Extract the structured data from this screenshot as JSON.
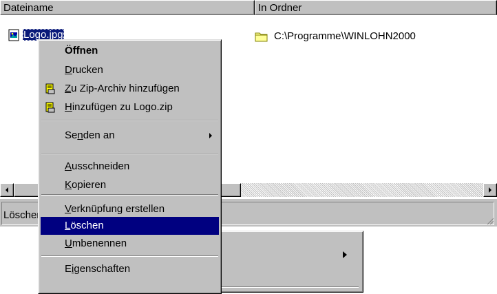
{
  "list": {
    "columns": [
      "Dateiname",
      "In Ordner"
    ],
    "rows": [
      {
        "name": "Logo.jpg",
        "folder": "C:\\Programme\\WINLOHN2000"
      }
    ]
  },
  "status": {
    "text": "Löschen"
  },
  "context_menu": {
    "items": [
      {
        "label": "Öffnen",
        "mnemonic": "",
        "bold": true
      },
      {
        "label": "Drucken",
        "mnemonic": "D"
      },
      {
        "label": "Zu Zip-Archiv hinzufügen",
        "mnemonic": "Z",
        "icon": "winzip-icon"
      },
      {
        "label": "Hinzufügen zu Logo.zip",
        "mnemonic": "H",
        "icon": "winzip-icon"
      },
      {
        "label": "Senden an",
        "mnemonic": "n",
        "submenu": true
      },
      {
        "label": "Ausschneiden",
        "mnemonic": "A"
      },
      {
        "label": "Kopieren",
        "mnemonic": "K"
      },
      {
        "label": "Verknüpfung erstellen",
        "mnemonic": "V"
      },
      {
        "label": "Löschen",
        "mnemonic": "L",
        "highlighted": true
      },
      {
        "label": "Umbenennen",
        "mnemonic": "U"
      },
      {
        "label": "Eigenschaften",
        "mnemonic": "i"
      }
    ]
  },
  "colors": {
    "selection": "#000080",
    "face": "#c0c0c0"
  }
}
